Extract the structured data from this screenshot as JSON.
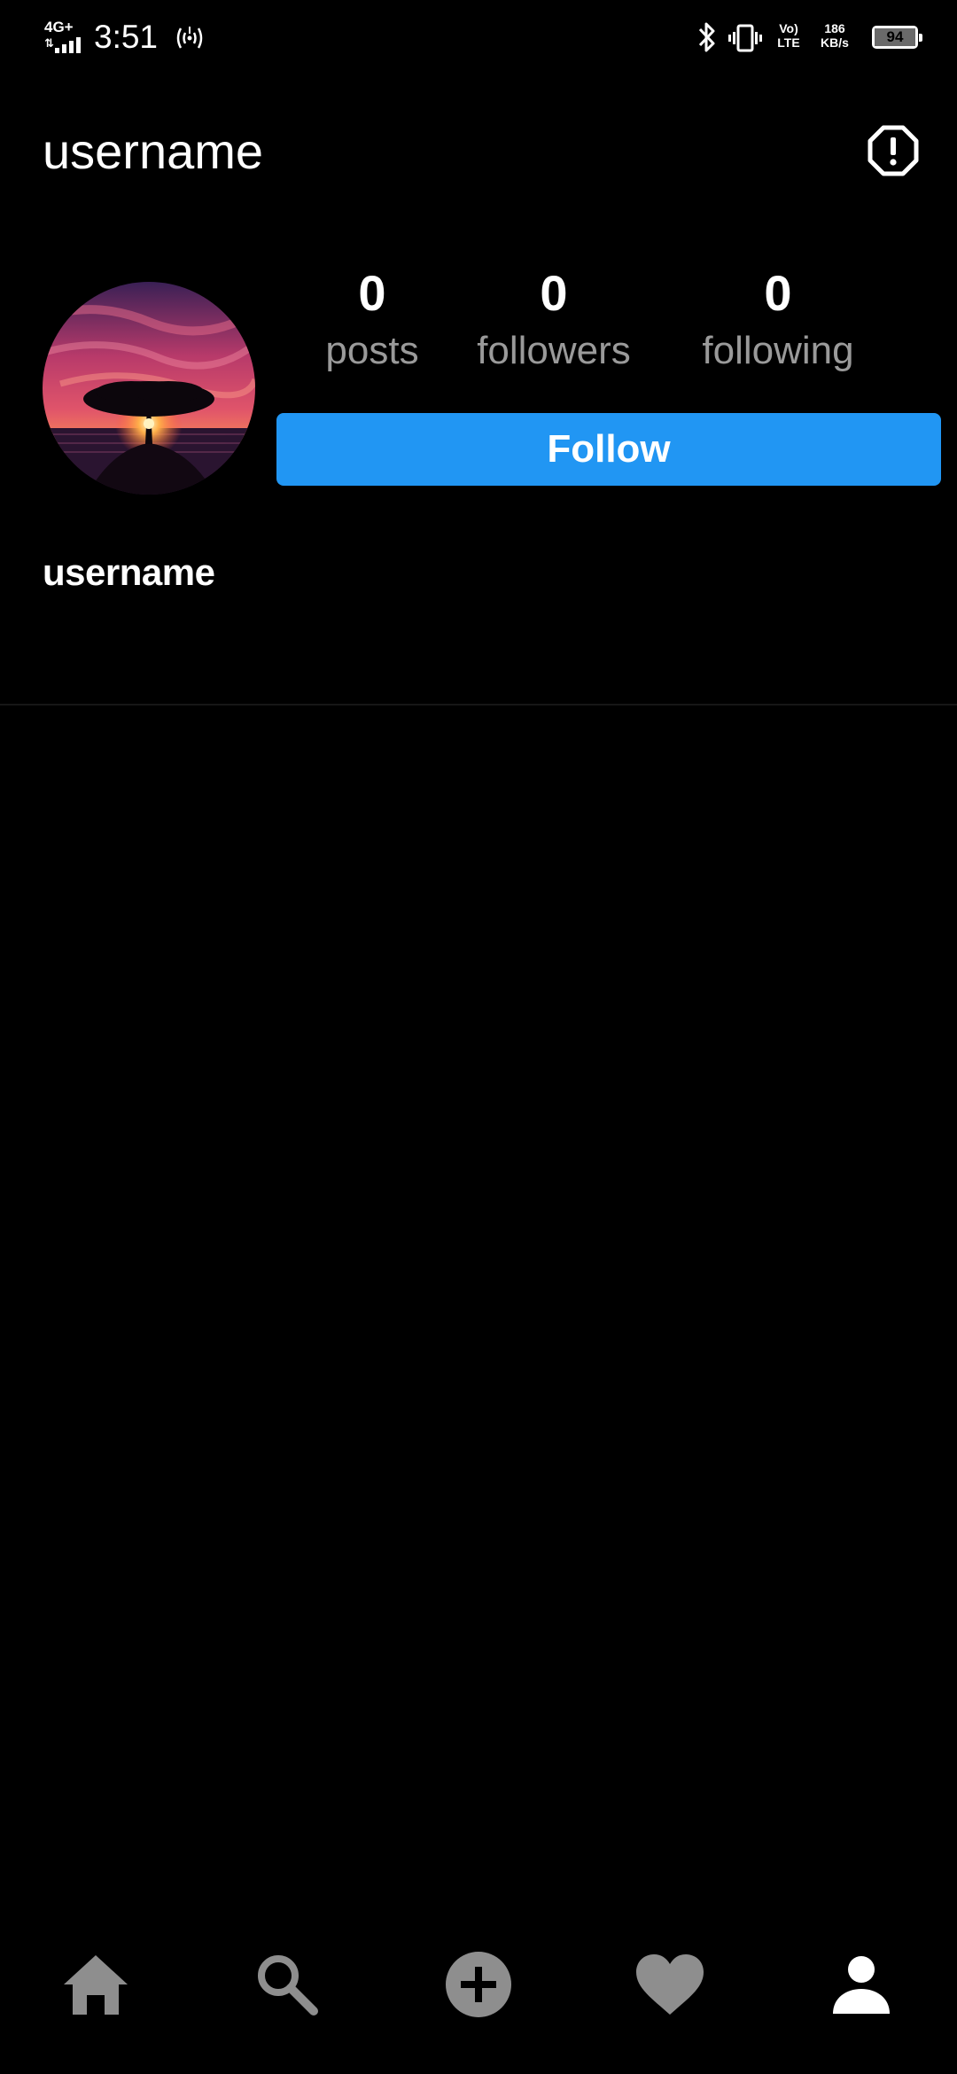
{
  "status_bar": {
    "network": "4G+",
    "time": "3:51",
    "volte_line1": "Vo)",
    "volte_line2": "LTE",
    "speed_value": "186",
    "speed_unit": "KB/s",
    "battery": "94"
  },
  "header": {
    "title": "username",
    "report_icon": "report-octagon-icon"
  },
  "profile": {
    "avatar": "sunset-tree-avatar",
    "stats": {
      "posts": {
        "count": "0",
        "label": "posts"
      },
      "followers": {
        "count": "0",
        "label": "followers"
      },
      "following": {
        "count": "0",
        "label": "following"
      }
    },
    "follow_label": "Follow",
    "display_name": "username"
  },
  "bottom_nav": {
    "items": [
      {
        "icon": "home-icon"
      },
      {
        "icon": "search-icon"
      },
      {
        "icon": "add-post-icon"
      },
      {
        "icon": "heart-icon"
      },
      {
        "icon": "profile-icon",
        "active": true
      }
    ]
  },
  "colors": {
    "background": "#000000",
    "accent": "#2196f3",
    "muted_text": "#9a9a9a",
    "inactive_icon": "#8e8e8e",
    "active_icon": "#ffffff"
  }
}
